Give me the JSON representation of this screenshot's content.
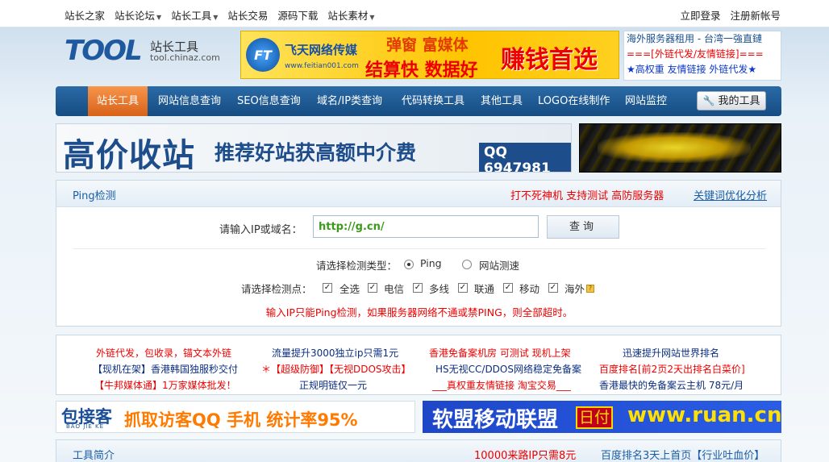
{
  "topnav": {
    "items": [
      {
        "label": "站长之家",
        "dropdown": false
      },
      {
        "label": "站长论坛",
        "dropdown": true
      },
      {
        "label": "站长工具",
        "dropdown": true
      },
      {
        "label": "站长交易",
        "dropdown": false
      },
      {
        "label": "源码下载",
        "dropdown": false
      },
      {
        "label": "站长素材",
        "dropdown": true
      }
    ],
    "login": "立即登录",
    "register": "注册新帐号"
  },
  "logo": {
    "brand": "TOOL",
    "cn": "站长工具",
    "domain": "tool.chinaz.com"
  },
  "banner_ad": {
    "company_logo": "FT",
    "company": "飞天网络传媒",
    "url": "www.feitian001.com",
    "line1": "弹窗 富媒体",
    "line2": "结算快 数据好",
    "headline": "赚钱首选"
  },
  "right_box": {
    "line1": "海外服务器租用 - 台湾一強直鏈",
    "line2": "===[外链代发/友情链接]===",
    "line3": "★高权重 友情链接 外链代发★"
  },
  "mainnav": {
    "items": [
      "站长工具",
      "网站信息查询",
      "SEO信息查询",
      "域名/IP类查询",
      "代码转换工具",
      "其他工具",
      "LOGO在线制作",
      "网站监控"
    ],
    "active_index": 0,
    "my_tools": "我的工具"
  },
  "big_banner": {
    "title": "高价收站",
    "subtitle": "推荐好站获高额中介费",
    "contact": "QQ 6947981"
  },
  "ping_panel": {
    "title": "Ping检测",
    "ad_text": "打不死神机 支持测试 高防服务器",
    "link_text": "关键词优化分析",
    "ip_label": "请输入IP或域名：",
    "ip_value": "http://g.cn/",
    "query_button": "查询",
    "type_label": "请选择检测类型：",
    "type_options": [
      "Ping",
      "网站测速"
    ],
    "type_selected": "Ping",
    "points_label": "请选择检测点：",
    "points": [
      "全选",
      "电信",
      "多线",
      "联通",
      "移动",
      "海外"
    ],
    "note": "输入IP只能Ping检测，如果服务器网络不通或禁PING，则全部超时。"
  },
  "link_grid": {
    "rows": [
      [
        "外链代发，包收录，锚文本外链",
        "流量提升3000独立ip只需1元",
        "香港免备案机房 可测试 现机上架",
        "迅速提升网站世界排名"
      ],
      [
        "【现机在架】香港韩国独服秒交付",
        "＊【超级防御】【无视DDOS攻击】",
        "HS无视CC/DDOS网络稳定免备案",
        "百度排名[前2页2天出排名白菜价]"
      ],
      [
        "【牛邦媒体通】1万家媒体批发！",
        "正规明链仅一元",
        "___真权重友情链接 淘宝交易___",
        "香港最快的免备案云主机 78元/月"
      ]
    ]
  },
  "bottom_ads": {
    "bao_logo": "包接客",
    "bao_sub": "BAO JIE KE",
    "bao_slogan": "抓取访客QQ 手机  统计率95%",
    "ruan_text": "软盟移动联盟",
    "ruan_badge": "日付",
    "ruan_url": "www.ruan.cn"
  },
  "bottom_panel": {
    "title": "工具简介",
    "ad_text": "10000来路IP只需8元",
    "link_text": "百度排名3天上首页【行业吐血价】"
  },
  "colors": {
    "nav_blue": "#1c568f",
    "nav_active": "#e8752c",
    "alert_red": "#ee0000",
    "link_blue": "#1a5ea6"
  }
}
